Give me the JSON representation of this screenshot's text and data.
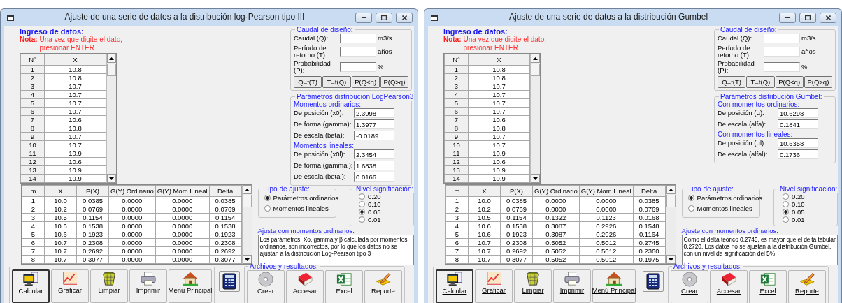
{
  "windows": [
    {
      "title": "Ajuste de una serie de datos a la distribución log-Pearson tipo III",
      "labels_underlined": false,
      "intro": {
        "heading": "Ingreso de datos:",
        "note_label": "Nota:",
        "note_text": "Una vez que digite el dato, presionar ENTER"
      },
      "data_table": {
        "columns": [
          "N°",
          "X"
        ],
        "rows": [
          [
            "1",
            "10.8"
          ],
          [
            "2",
            "10.8"
          ],
          [
            "3",
            "10.7"
          ],
          [
            "4",
            "10.7"
          ],
          [
            "5",
            "10.7"
          ],
          [
            "6",
            "10.7"
          ],
          [
            "7",
            "10.6"
          ],
          [
            "8",
            "10.8"
          ],
          [
            "9",
            "10.7"
          ],
          [
            "10",
            "10.7"
          ],
          [
            "11",
            "10.9"
          ],
          [
            "12",
            "10.6"
          ],
          [
            "13",
            "10.9"
          ],
          [
            "14",
            "10.9"
          ]
        ]
      },
      "design_flow": {
        "title": "Caudal de diseño:",
        "fields": [
          {
            "label": "Caudal (Q):",
            "unit": "m3/s"
          },
          {
            "label": "Período de retorno (T):",
            "unit": "años"
          },
          {
            "label": "Probabilidad (P):",
            "unit": "%"
          }
        ],
        "buttons": [
          "Q=f(T)",
          "T=f(Q)",
          "P(Q<q)",
          "P(Q>q)"
        ]
      },
      "parameters": {
        "title": "Parámetros distribución LogPearson3:",
        "groups": [
          {
            "heading": "Momentos ordinarios:",
            "fields": [
              {
                "label": "De posición (x0):",
                "value": "2.3998"
              },
              {
                "label": "De forma (gamma):",
                "value": "1.3977"
              },
              {
                "label": "De escala (beta):",
                "value": "-0.0189"
              }
            ]
          },
          {
            "heading": "Momentos lineales:",
            "fields": [
              {
                "label": "De posición (x0l):",
                "value": "2.3454"
              },
              {
                "label": "De forma (gammal):",
                "value": "1.6838"
              },
              {
                "label": "De escala (betal):",
                "value": "0.0166"
              }
            ]
          }
        ]
      },
      "results_table": {
        "columns": [
          "m",
          "X",
          "P(X)",
          "G(Y) Ordinario",
          "G(Y) Mom Lineal",
          "Delta"
        ],
        "rows": [
          [
            "1",
            "10.0",
            "0.0385",
            "0.0000",
            "0.0000",
            "0.0385"
          ],
          [
            "2",
            "10.2",
            "0.0769",
            "0.0000",
            "0.0000",
            "0.0769"
          ],
          [
            "3",
            "10.5",
            "0.1154",
            "0.0000",
            "0.0000",
            "0.1154"
          ],
          [
            "4",
            "10.6",
            "0.1538",
            "0.0000",
            "0.0000",
            "0.1538"
          ],
          [
            "5",
            "10.6",
            "0.1923",
            "0.0000",
            "0.0000",
            "0.1923"
          ],
          [
            "6",
            "10.7",
            "0.2308",
            "0.0000",
            "0.0000",
            "0.2308"
          ],
          [
            "7",
            "10.7",
            "0.2692",
            "0.0000",
            "0.0000",
            "0.2692"
          ],
          [
            "8",
            "10.7",
            "0.3077",
            "0.0000",
            "0.0000",
            "0.3077"
          ]
        ]
      },
      "fit_type": {
        "title": "Tipo de ajuste:",
        "options": [
          {
            "label": "Parámetros ordinarios",
            "selected": true
          },
          {
            "label": "Momentos lineales",
            "selected": false
          }
        ]
      },
      "significance": {
        "title": "Nivel significación:",
        "options": [
          {
            "label": "0.20",
            "selected": false
          },
          {
            "label": "0.10",
            "selected": false
          },
          {
            "label": "0.05",
            "selected": true
          },
          {
            "label": "0.01",
            "selected": false
          }
        ]
      },
      "conclusion": {
        "title": "Ajuste con momentos ordinarios:",
        "text": "Los parámetros: Xo, gamma y β calculada por momentos ordinarios, son incorrectos, por lo que los datos no se ajustan a la distribución Log-Pearson tipo 3"
      },
      "toolbar": [
        {
          "label": "Calcular",
          "kind": "computer",
          "focused": true
        },
        {
          "label": "Graficar",
          "kind": "chart",
          "focused": false
        },
        {
          "label": "Limpiar",
          "kind": "basket",
          "focused": false
        },
        {
          "label": "Imprimir",
          "kind": "printer",
          "focused": false
        },
        {
          "label": "Menú Principal",
          "kind": "house",
          "focused": false
        }
      ],
      "files": {
        "title": "Archivos y resultados:",
        "buttons": [
          {
            "label": "Crear",
            "kind": "disc"
          },
          {
            "label": "Accesar",
            "kind": "book"
          },
          {
            "label": "Excel",
            "kind": "spreadsheet"
          },
          {
            "label": "Reporte",
            "kind": "pencil"
          }
        ]
      }
    },
    {
      "title": "Ajuste de una serie de datos a la distribución Gumbel",
      "labels_underlined": true,
      "intro": {
        "heading": "Ingreso de datos:",
        "note_label": "Nota:",
        "note_text": "Una vez que digite el dato, presionar ENTER"
      },
      "data_table": {
        "columns": [
          "N°",
          "X"
        ],
        "rows": [
          [
            "1",
            "10.8"
          ],
          [
            "2",
            "10.8"
          ],
          [
            "3",
            "10.7"
          ],
          [
            "4",
            "10.7"
          ],
          [
            "5",
            "10.7"
          ],
          [
            "6",
            "10.7"
          ],
          [
            "7",
            "10.6"
          ],
          [
            "8",
            "10.8"
          ],
          [
            "9",
            "10.7"
          ],
          [
            "10",
            "10.7"
          ],
          [
            "11",
            "10.9"
          ],
          [
            "12",
            "10.6"
          ],
          [
            "13",
            "10.9"
          ],
          [
            "14",
            "10.9"
          ]
        ]
      },
      "design_flow": {
        "title": "Caudal de diseño:",
        "fields": [
          {
            "label": "Caudal (Q):",
            "unit": "m3/s"
          },
          {
            "label": "Período de retorno (T):",
            "unit": "años"
          },
          {
            "label": "Probabilidad (P):",
            "unit": "%"
          }
        ],
        "buttons": [
          "Q=f(T)",
          "T=f(Q)",
          "P(Q<q)",
          "P(Q>q)"
        ]
      },
      "parameters": {
        "title": "Parámetros distribución Gumbel:",
        "groups": [
          {
            "heading": "Con momentos ordinarios:",
            "fields": [
              {
                "label": "De posición (µ):",
                "value": "10.6298"
              },
              {
                "label": "De escala (alfa):",
                "value": "0.1841"
              }
            ]
          },
          {
            "heading": "Con momentos lineales:",
            "fields": [
              {
                "label": "De posición (µl):",
                "value": "10.6358"
              },
              {
                "label": "De escala (alfal):",
                "value": "0.1736"
              }
            ]
          }
        ]
      },
      "results_table": {
        "columns": [
          "m",
          "X",
          "P(X)",
          "G(Y) Ordinario",
          "G(Y) Mom Lineal",
          "Delta"
        ],
        "rows": [
          [
            "1",
            "10.0",
            "0.0385",
            "0.0000",
            "0.0000",
            "0.0385"
          ],
          [
            "2",
            "10.2",
            "0.0769",
            "0.0000",
            "0.0000",
            "0.0769"
          ],
          [
            "3",
            "10.5",
            "0.1154",
            "0.1322",
            "0.1123",
            "0.0168"
          ],
          [
            "4",
            "10.6",
            "0.1538",
            "0.3087",
            "0.2926",
            "0.1548"
          ],
          [
            "5",
            "10.6",
            "0.1923",
            "0.3087",
            "0.2926",
            "0.1164"
          ],
          [
            "6",
            "10.7",
            "0.2308",
            "0.5052",
            "0.5012",
            "0.2745"
          ],
          [
            "7",
            "10.7",
            "0.2692",
            "0.5052",
            "0.5012",
            "0.2360"
          ],
          [
            "8",
            "10.7",
            "0.3077",
            "0.5052",
            "0.5012",
            "0.1975"
          ]
        ]
      },
      "fit_type": {
        "title": "Tipo de ajuste:",
        "options": [
          {
            "label": "Parámetros ordinarios",
            "selected": true
          },
          {
            "label": "Momentos lineales",
            "selected": false
          }
        ]
      },
      "significance": {
        "title": "Nivel significación:",
        "options": [
          {
            "label": "0.20",
            "selected": false
          },
          {
            "label": "0.10",
            "selected": false
          },
          {
            "label": "0.05",
            "selected": true
          },
          {
            "label": "0.01",
            "selected": false
          }
        ]
      },
      "conclusion": {
        "title": "Ajuste con momentos ordinarios:",
        "text": "Como el delta teórico 0.2745, es mayor que el delta tabular 0.2720. Los datos no se ajustan a la distribución Gumbel, con un nivel de significación del 5%"
      },
      "toolbar": [
        {
          "label": "Calcular",
          "kind": "computer",
          "focused": true
        },
        {
          "label": "Graficar",
          "kind": "chart",
          "focused": false
        },
        {
          "label": "Limpiar",
          "kind": "basket",
          "focused": false
        },
        {
          "label": "Imprimir",
          "kind": "printer",
          "focused": false
        },
        {
          "label": "Menú Principal",
          "kind": "house",
          "focused": false
        }
      ],
      "files": {
        "title": "Archivos y resultados:",
        "buttons": [
          {
            "label": "Crear",
            "kind": "disc"
          },
          {
            "label": "Accesar",
            "kind": "book"
          },
          {
            "label": "Excel",
            "kind": "spreadsheet"
          },
          {
            "label": "Reporte",
            "kind": "pencil"
          }
        ]
      }
    }
  ]
}
